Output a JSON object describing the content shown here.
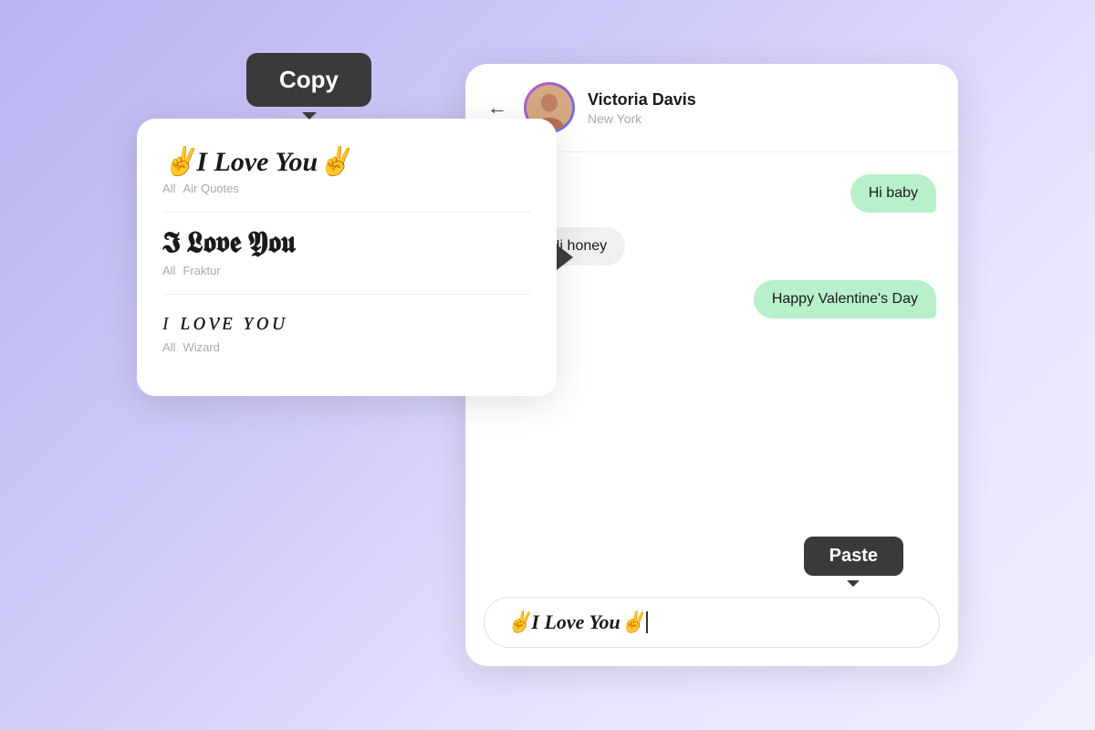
{
  "scene": {
    "background": "linear-gradient(135deg, #b8b4f0, #d0ccf8, #e8e4ff)"
  },
  "font_panel": {
    "copy_tooltip": "Copy",
    "items": [
      {
        "text": "✌️I Love You✌️",
        "style": "air-quotes",
        "tags": [
          "All",
          "Air Quotes"
        ]
      },
      {
        "text": "𝕴 𝕷𝖔𝖛𝖊 𝖄𝖔𝖚",
        "style": "fraktur",
        "tags": [
          "All",
          "Fraktur"
        ]
      },
      {
        "text": "ɪ ʟᴏᴠᴇ ʏᴏᴜ",
        "style": "wizard",
        "tags": [
          "All",
          "Wizard"
        ]
      }
    ]
  },
  "chat": {
    "contact_name": "Victoria Davis",
    "contact_location": "New York",
    "messages": [
      {
        "type": "sent",
        "text": "Hi baby"
      },
      {
        "type": "received",
        "text": "Hi honey"
      },
      {
        "type": "sent",
        "text": "Happy Valentine's Day"
      }
    ],
    "input_value": "✌️I Love You✌️",
    "paste_tooltip": "Paste"
  },
  "icons": {
    "back_arrow": "←",
    "panel_arrow": "▶"
  }
}
